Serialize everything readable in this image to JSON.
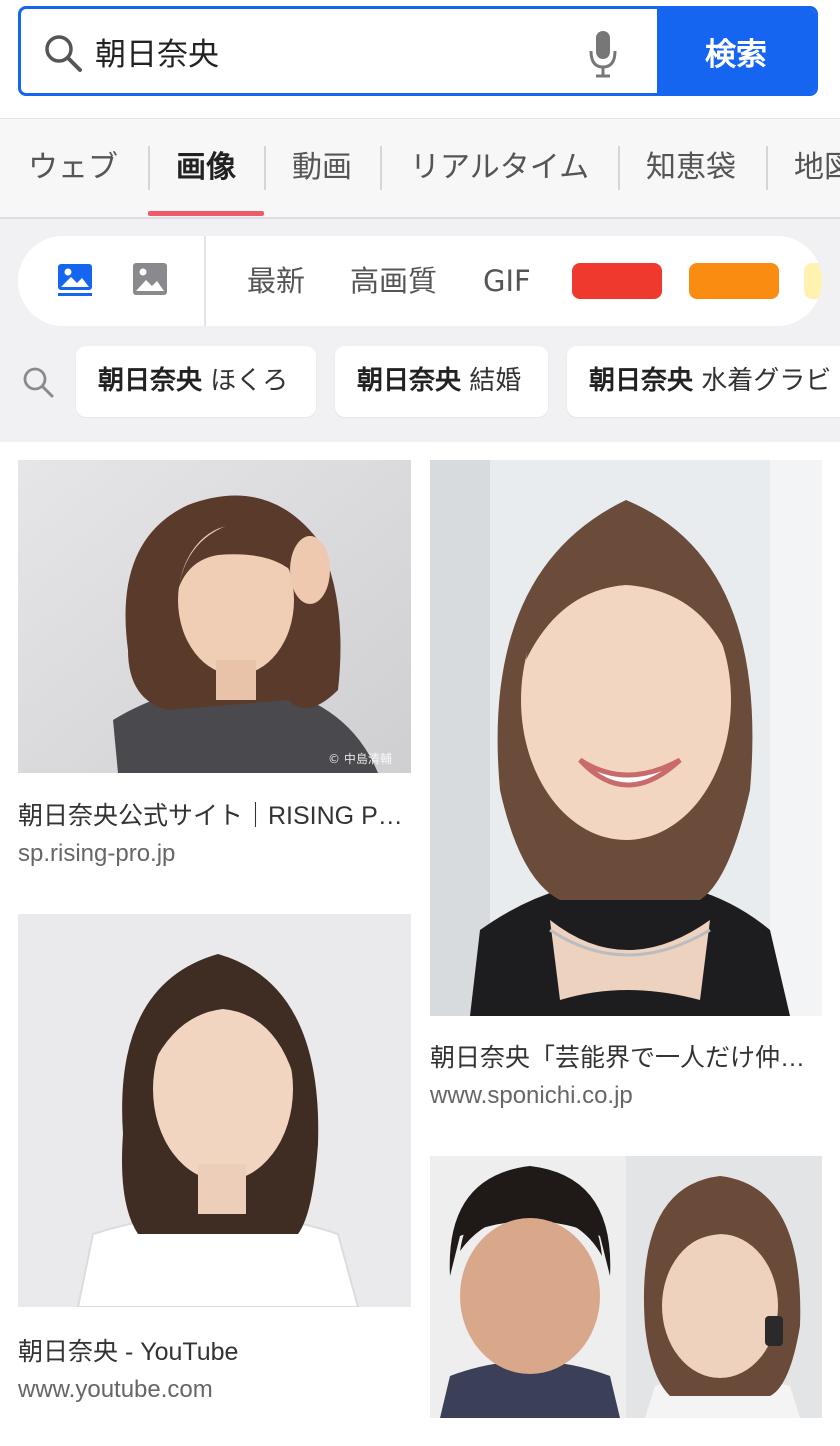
{
  "search": {
    "query": "朝日奈央",
    "button_label": "検索",
    "search_icon": "search-icon",
    "mic_icon": "microphone-icon"
  },
  "tabs": [
    {
      "label": "ウェブ",
      "active": false
    },
    {
      "label": "画像",
      "active": true
    },
    {
      "label": "動画",
      "active": false
    },
    {
      "label": "リアルタイム",
      "active": false
    },
    {
      "label": "知恵袋",
      "active": false
    },
    {
      "label": "地図",
      "active": false
    }
  ],
  "filters": {
    "icons": [
      "image-illustration-icon",
      "image-photo-icon"
    ],
    "labels": [
      "最新",
      "高画質",
      "GIF"
    ],
    "colors": [
      "#f0392e",
      "#fb8c12",
      "#fff2b0"
    ],
    "accent": "#1565f0",
    "underline": "#ee5a6a"
  },
  "suggestions": [
    {
      "bold": "朝日奈央",
      "rest": "ほくろ"
    },
    {
      "bold": "朝日奈央",
      "rest": "結婚"
    },
    {
      "bold": "朝日奈央",
      "rest": "水着グラビ"
    }
  ],
  "results": [
    {
      "title": "朝日奈央公式サイト｜RISING PRODUCTION",
      "source": "sp.rising-pro.jp",
      "watermark": "© 中島清輔"
    },
    {
      "title": "朝日奈央「芸能界で一人だけ仲間外れ",
      "source": "www.sponichi.co.jp"
    },
    {
      "title": "朝日奈央 - YouTube",
      "source": "www.youtube.com"
    },
    {
      "title": "",
      "source": ""
    }
  ]
}
